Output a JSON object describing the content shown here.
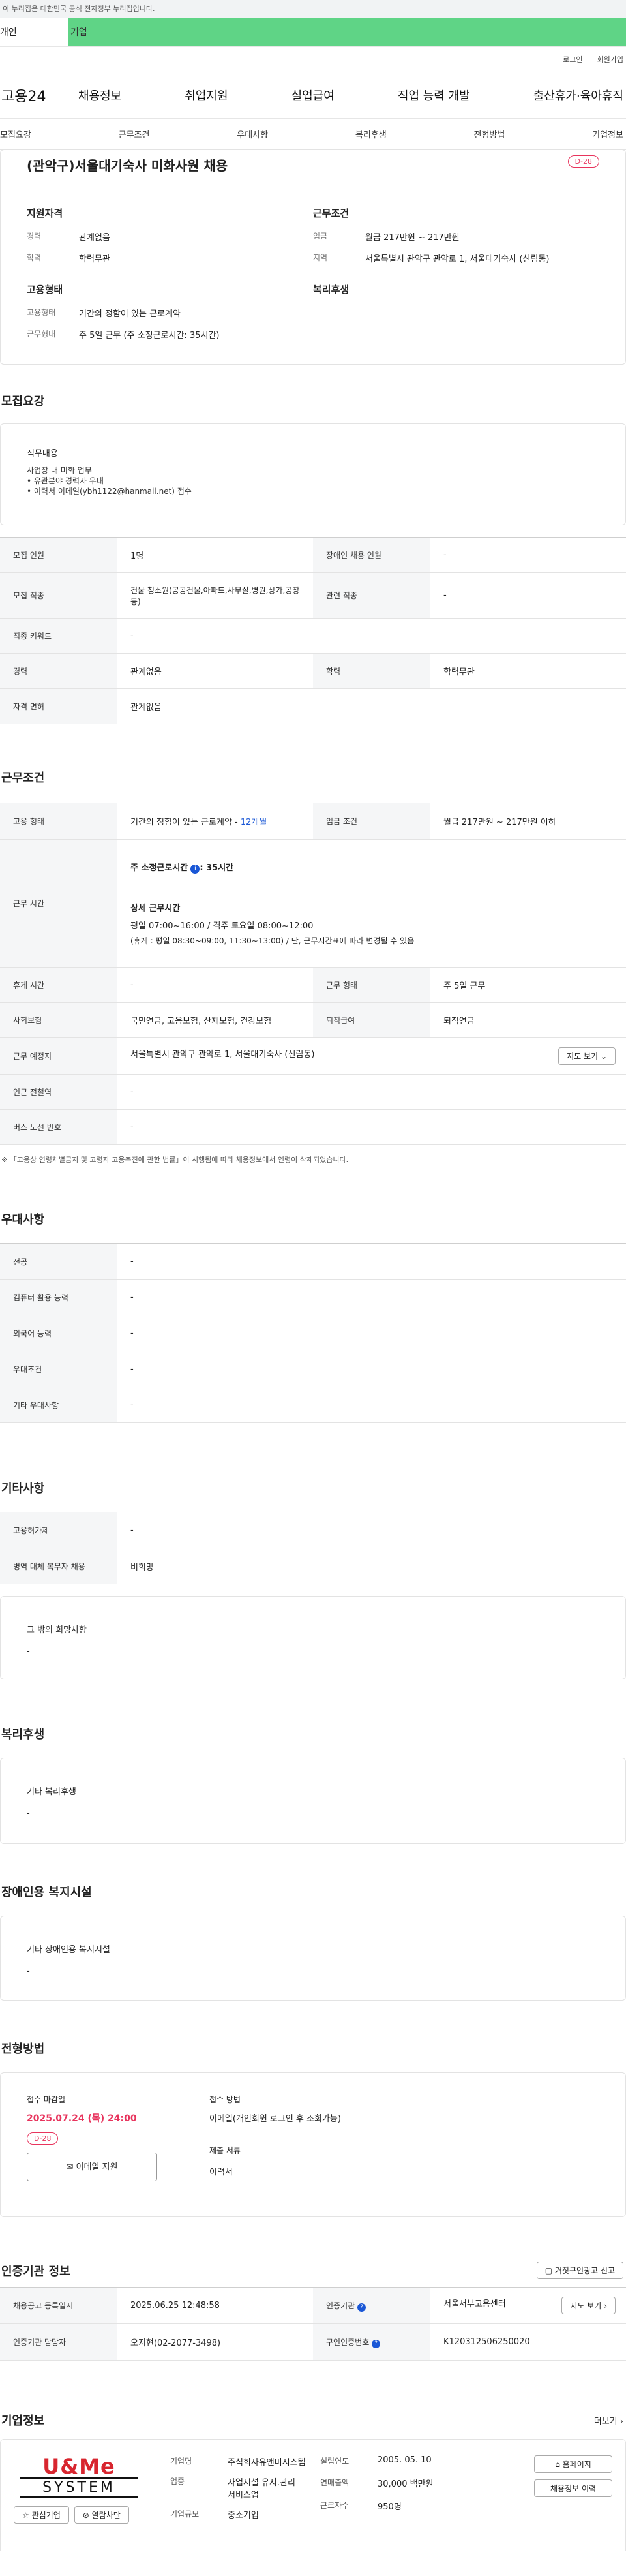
{
  "gov_banner": "이 누리집은 대한민국 공식 전자정부 누리집입니다.",
  "tabs": [
    "개인",
    "기업"
  ],
  "util": [
    "로그인",
    "회원가입"
  ],
  "logo": "고용24",
  "gnb": [
    "채용정보",
    "취업지원",
    "실업급여",
    "직업 능력 개발",
    "출산휴가·육아휴직"
  ],
  "anchors": [
    "모집요강",
    "근무조건",
    "우대사항",
    "복리후생",
    "전형방법",
    "기업정보"
  ],
  "title": "(관악구)서울대기숙사 미화사원 채용",
  "dday": "D-28",
  "summary": {
    "qual_h": "지원자격",
    "cond_h": "근무조건",
    "emp_h": "고용형태",
    "welfare_h": "복리후생",
    "career_k": "경력",
    "career": "관계없음",
    "edu_k": "학력",
    "edu": "학력무관",
    "wage_k": "임금",
    "wage": "월급 217만원 ~ 217만원",
    "loc_k": "지역",
    "loc": "서울특별시 관악구 관악로 1, 서울대기숙사 (신림동)",
    "emptype_k": "고용형태",
    "emptype": "기간의 정함이 있는 근로계약",
    "worktype_k": "근무형태",
    "worktype": "주 5일 근무 (주 소정근로시간: 35시간)"
  },
  "recruit": {
    "title": "모집요강",
    "duty_h": "직무내용",
    "duty": [
      "사업장 내 미화 업무",
      "• 유관분야 경력자 우대",
      "• 이력서 이메일(ybh1122@hanmail.net) 접수"
    ],
    "rows": [
      [
        "모집 인원",
        "1명",
        "장애인 채용 인원",
        "-"
      ],
      [
        "모집 직종",
        "건물 청소원(공공건물,아파트,사무실,병원,상가,공장 등)",
        "관련 직종",
        "-"
      ],
      [
        "직종 키워드",
        "-"
      ],
      [
        "경력",
        "관계없음",
        "학력",
        "학력무관"
      ],
      [
        "자격 면허",
        "관계없음"
      ]
    ]
  },
  "workcond": {
    "title": "근무조건",
    "emp_k": "고용 형태",
    "emp": "기간의 정함이 있는 근로계약 - ",
    "emp_months": "12개월",
    "wage_k": "임금 조건",
    "wage": "월급 217만원 ~ 217만원 이하",
    "time_k": "근무 시간",
    "time_total": "주 소정근로시간",
    "time_hours": ": 35시간",
    "time_detail_h": "상세 근무시간",
    "time_detail": [
      "평일 07:00~16:00 / 격주 토요일 08:00~12:00",
      "(휴게 : 평일 08:30~09:00, 11:30~13:00) / 단, 근무시간표에 따라 변경될 수 있음"
    ],
    "rest_k": "휴게 시간",
    "rest": "-",
    "form_k": "근무 형태",
    "form": "주 5일 근무",
    "ins_k": "사회보험",
    "ins": "국민연금, 고용보험, 산재보험, 건강보험",
    "ret_k": "퇴직급여",
    "ret": "퇴직연금",
    "place_k": "근무 예정지",
    "place": "서울특별시 관악구 관악로 1, 서울대기숙사 (신림동)",
    "map_btn": "지도 보기",
    "sub_k": "인근 전철역",
    "sub": "-",
    "bus_k": "버스 노선 번호",
    "bus": "-",
    "note": "※ 「고용상 연령차별금지 및 고령자 고용촉진에 관한 법률」이 시행됨에 따라 채용정보에서 연령이 삭제되었습니다."
  },
  "pref": {
    "title": "우대사항",
    "rows": [
      [
        "전공",
        "-"
      ],
      [
        "컴퓨터 활용 능력",
        "-"
      ],
      [
        "외국어 능력",
        "-"
      ],
      [
        "우대조건",
        "-"
      ],
      [
        "기타 우대사항",
        "-"
      ]
    ]
  },
  "etc": {
    "title": "기타사항",
    "rows": [
      [
        "고용허가제",
        "-"
      ],
      [
        "병역 대체 복무자 채용",
        "비희망"
      ]
    ],
    "other_h": "그 밖의 희망사항",
    "other": "-"
  },
  "welfare": {
    "title": "복리후생",
    "h": "기타 복리후생",
    "v": "-"
  },
  "disab": {
    "title": "장애인용 복지시설",
    "h": "기타 장애인용 복지시설",
    "v": "-"
  },
  "select": {
    "title": "전형방법",
    "deadline_h": "접수 마감일",
    "deadline": "2025.07.24 (목) 24:00",
    "dday": "D-28",
    "email_btn": "이메일 지원",
    "method_h": "접수 방법",
    "method": "이메일(개인회원 로그인 후 조회가능)",
    "docs_h": "제출 서류",
    "docs": "이력서"
  },
  "cert": {
    "title": "인증기관 정보",
    "report_btn": "거짓구인광고 신고",
    "reg_k": "채용공고 등록일시",
    "reg": "2025.06.25 12:48:58",
    "org_k": "인증기관",
    "org": "서울서부고용센터",
    "map_btn": "지도 보기",
    "mgr_k": "인증기관 담당자",
    "mgr": "오지현(02-2077-3498)",
    "no_k": "구인인증번호",
    "no": "K120312506250020"
  },
  "company": {
    "title": "기업정보",
    "more": "더보기",
    "logo_top": "U&Me",
    "logo_bot": "SYSTEM",
    "fav": "관심기업",
    "block": "열람차단",
    "name_k": "기업명",
    "name": "주식회사유앤미시스템",
    "ind_k": "업종",
    "ind": "사업시설 유지.관리 서비스업",
    "size_k": "기업규모",
    "size": "중소기업",
    "year_k": "설립연도",
    "year": "2005. 05. 10",
    "sales_k": "연매출액",
    "sales": "30,000 백만원",
    "emp_k": "근로자수",
    "emp": "950명",
    "home_btn": "홈페이지",
    "hist_btn": "채용정보 이력"
  },
  "colors": {
    "accent": "#5fd486",
    "dday": "#e8345d",
    "link": "#1a57d6"
  }
}
